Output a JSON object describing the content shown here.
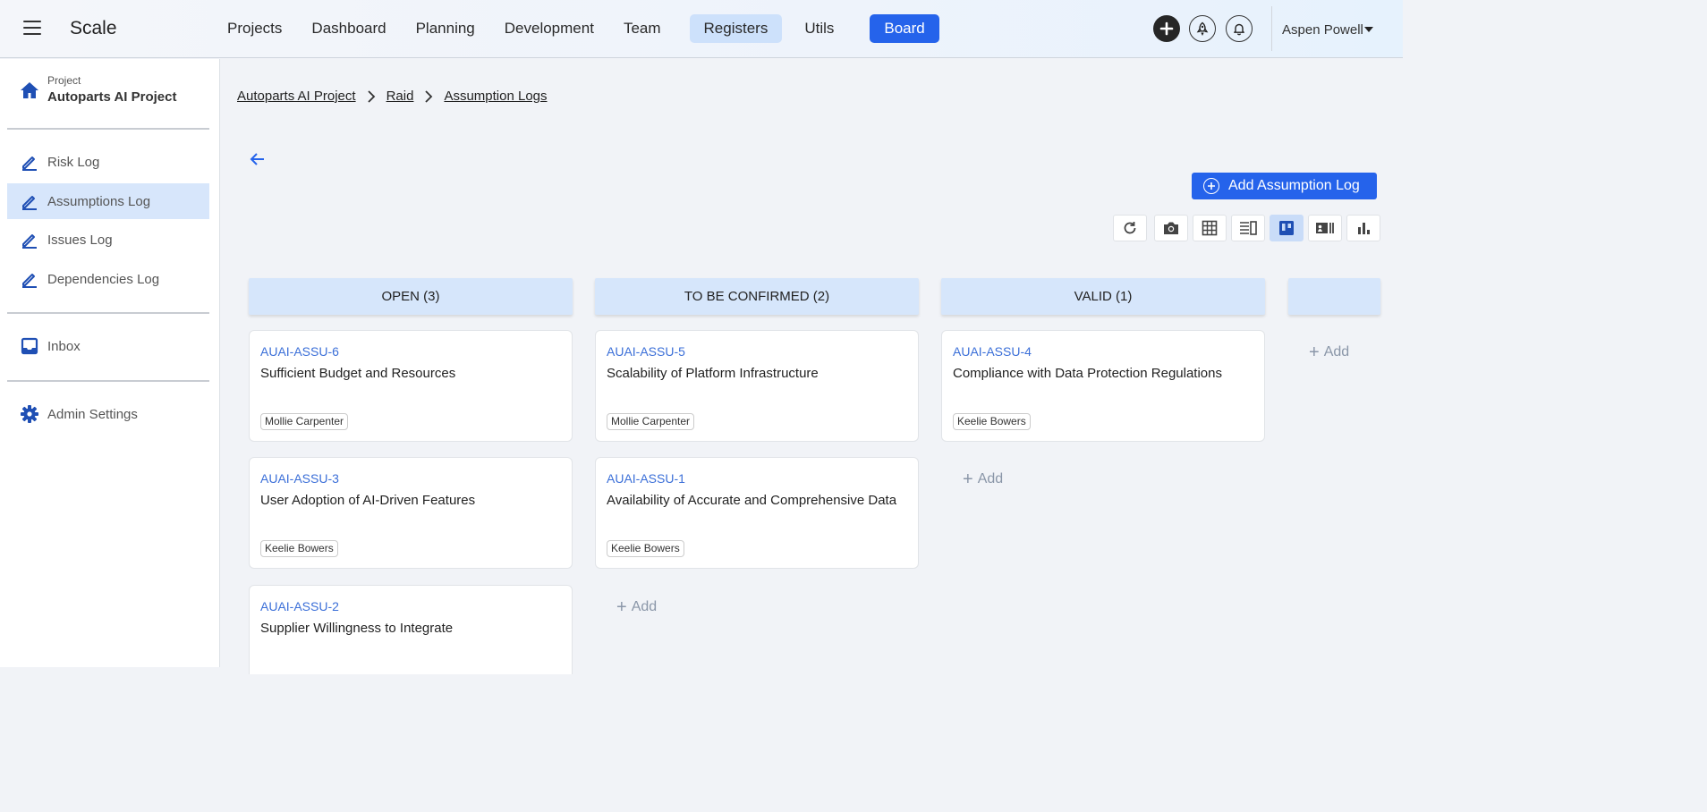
{
  "app": {
    "title": "Scale"
  },
  "nav": {
    "items": [
      {
        "label": "Projects",
        "state": "normal"
      },
      {
        "label": "Dashboard",
        "state": "normal"
      },
      {
        "label": "Planning",
        "state": "normal"
      },
      {
        "label": "Development",
        "state": "normal"
      },
      {
        "label": "Team",
        "state": "normal"
      },
      {
        "label": "Registers",
        "state": "active-soft"
      },
      {
        "label": "Utils",
        "state": "normal"
      },
      {
        "label": "Board",
        "state": "active-primary"
      }
    ]
  },
  "user": {
    "name": "Aspen Powell"
  },
  "sidebar": {
    "project_small": "Project",
    "project_name": "Autoparts AI Project",
    "items": [
      {
        "label": "Risk Log",
        "icon": "edit-icon"
      },
      {
        "label": "Assumptions Log",
        "icon": "edit-icon",
        "active": true
      },
      {
        "label": "Issues Log",
        "icon": "edit-icon"
      },
      {
        "label": "Dependencies Log",
        "icon": "edit-icon"
      },
      {
        "label": "Inbox",
        "icon": "inbox-icon"
      },
      {
        "label": "Admin Settings",
        "icon": "gear-icon"
      }
    ]
  },
  "breadcrumb": [
    "Autoparts AI Project",
    "Raid",
    "Assumption Logs"
  ],
  "actions": {
    "add_label": "Add Assumption Log"
  },
  "toolbar": [
    "refresh-icon",
    "camera-icon",
    "table-icon",
    "list-icon",
    "board-icon",
    "card-icon",
    "chart-icon"
  ],
  "board": {
    "add_label": "Add",
    "columns": [
      {
        "title": "OPEN (3)",
        "cards": [
          {
            "id": "AUAI-ASSU-6",
            "title": "Sufficient Budget and Resources",
            "owner": "Mollie Carpenter"
          },
          {
            "id": "AUAI-ASSU-3",
            "title": "User Adoption of AI-Driven Features",
            "owner": "Keelie Bowers"
          },
          {
            "id": "AUAI-ASSU-2",
            "title": "Supplier Willingness to Integrate",
            "owner": ""
          }
        ]
      },
      {
        "title": "TO BE CONFIRMED (2)",
        "cards": [
          {
            "id": "AUAI-ASSU-5",
            "title": "Scalability of Platform Infrastructure",
            "owner": "Mollie Carpenter"
          },
          {
            "id": "AUAI-ASSU-1",
            "title": "Availability of Accurate and Comprehensive Data",
            "owner": "Keelie Bowers"
          }
        ]
      },
      {
        "title": "VALID (1)",
        "cards": [
          {
            "id": "AUAI-ASSU-4",
            "title": "Compliance with Data Protection Regulations",
            "owner": "Keelie Bowers"
          }
        ]
      },
      {
        "title": "",
        "cards": []
      }
    ]
  },
  "colors": {
    "primary": "#2563eb",
    "soft": "#d6e6fb",
    "link": "#3b6fd8"
  }
}
